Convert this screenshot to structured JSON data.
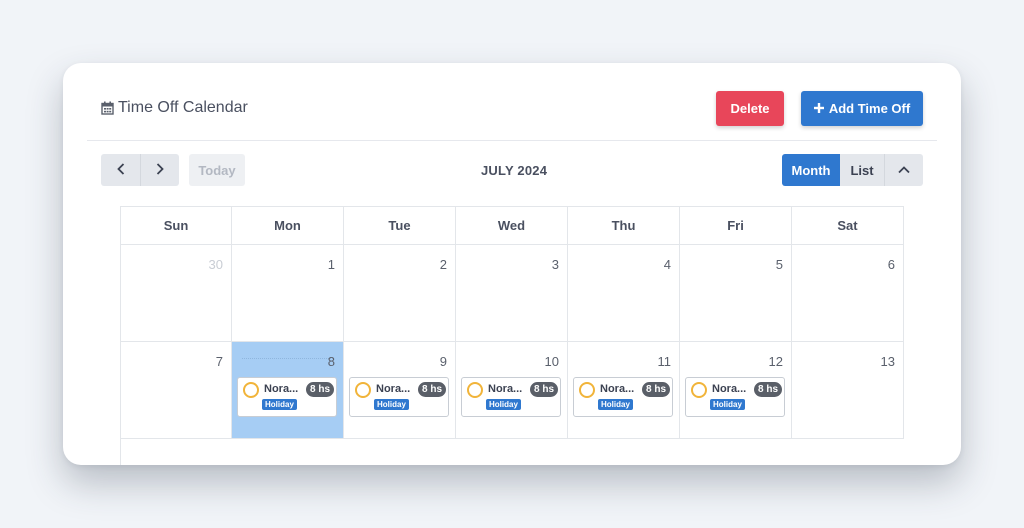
{
  "header": {
    "title": "Time Off Calendar",
    "title_icon": "calendar-icon",
    "delete_label": "Delete",
    "add_label": "Add Time Off",
    "add_icon": "plus-icon",
    "colors": {
      "delete": "#e8465a",
      "primary": "#2f78cf"
    }
  },
  "toolbar": {
    "prev_icon": "chevron-left-icon",
    "next_icon": "chevron-right-icon",
    "today_label": "Today",
    "month_label": "JULY 2024",
    "view_month_label": "Month",
    "view_list_label": "List",
    "active_view": "Month",
    "collapse_icon": "chevron-up-icon"
  },
  "calendar": {
    "weekdays": [
      "Sun",
      "Mon",
      "Tue",
      "Wed",
      "Thu",
      "Fri",
      "Sat"
    ],
    "selected_day": "8",
    "weeks": [
      {
        "days": [
          {
            "num": "30",
            "other": true
          },
          {
            "num": "1"
          },
          {
            "num": "2"
          },
          {
            "num": "3"
          },
          {
            "num": "4"
          },
          {
            "num": "5"
          },
          {
            "num": "6"
          }
        ]
      },
      {
        "days": [
          {
            "num": "7"
          },
          {
            "num": "8",
            "event": {
              "name": "Nora...",
              "hours": "8 hs",
              "tag": "Holiday"
            }
          },
          {
            "num": "9",
            "event": {
              "name": "Nora...",
              "hours": "8 hs",
              "tag": "Holiday"
            }
          },
          {
            "num": "10",
            "event": {
              "name": "Nora...",
              "hours": "8 hs",
              "tag": "Holiday"
            }
          },
          {
            "num": "11",
            "event": {
              "name": "Nora...",
              "hours": "8 hs",
              "tag": "Holiday"
            }
          },
          {
            "num": "12",
            "event": {
              "name": "Nora...",
              "hours": "8 hs",
              "tag": "Holiday"
            }
          },
          {
            "num": "13"
          }
        ]
      }
    ]
  }
}
